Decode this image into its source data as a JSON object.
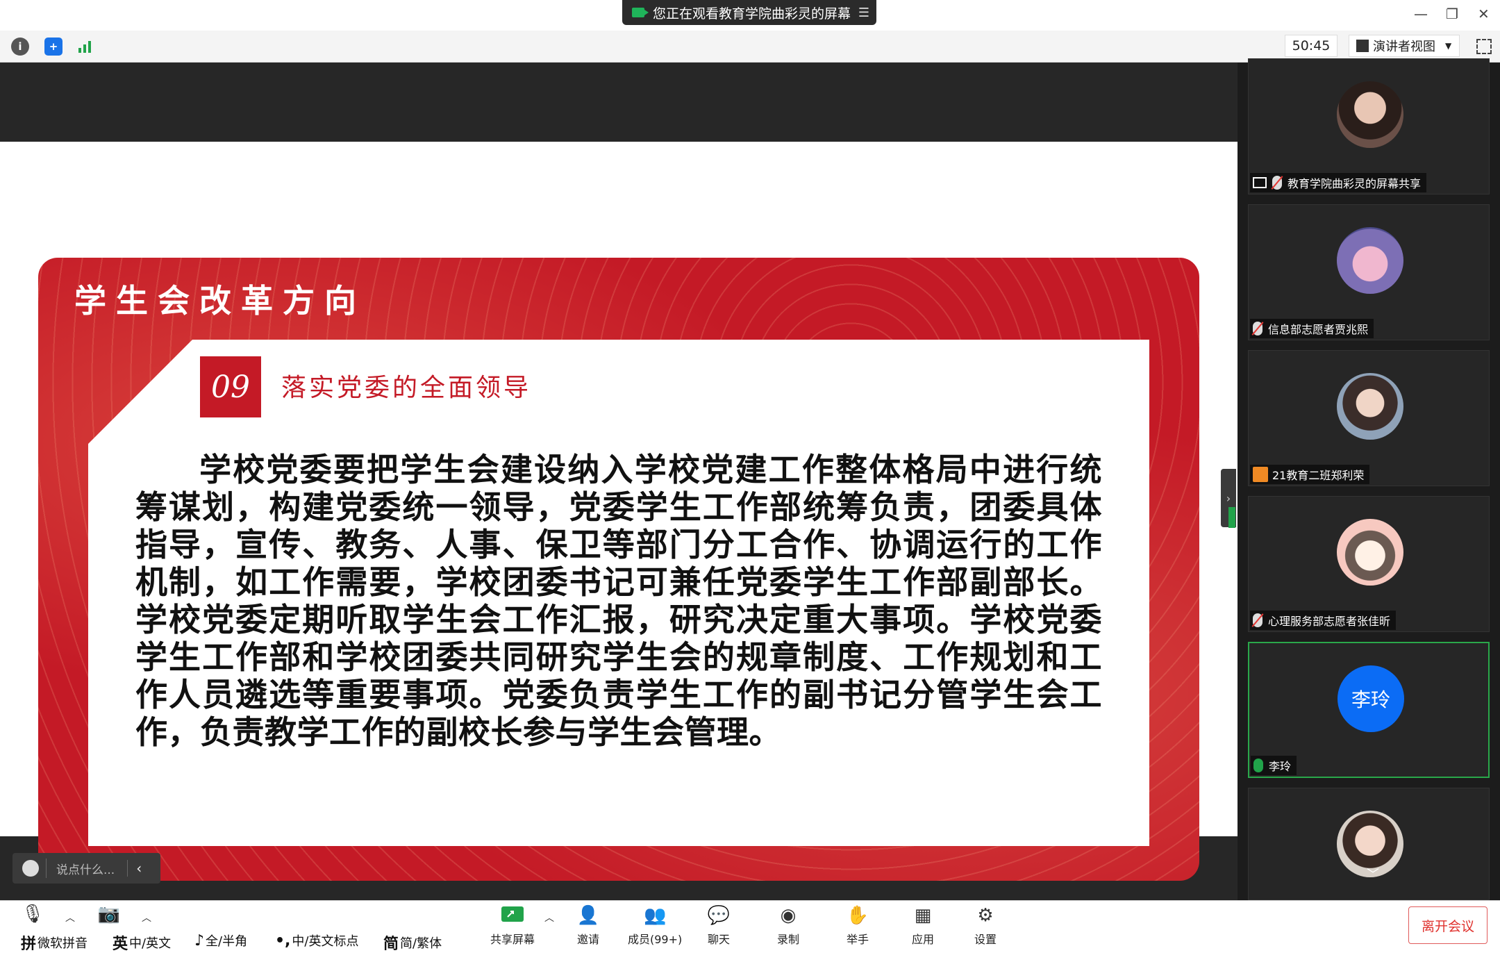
{
  "banner": {
    "text": "您正在观看教育学院曲彩灵的屏幕",
    "menu_icon": "menu-icon"
  },
  "window_controls": {
    "minimize": "—",
    "restore": "❐",
    "close": "✕"
  },
  "topbar": {
    "timer": "50:45",
    "view_mode": "演讲者视图"
  },
  "slide": {
    "title": "学生会改革方向",
    "number": "09",
    "subtitle": "落实党委的全面领导",
    "body": "学校党委要把学生会建设纳入学校党建工作整体格局中进行统筹谋划，构建党委统一领导，党委学生工作部统筹负责，团委具体指导，宣传、教务、人事、保卫等部门分工合作、协调运行的工作机制，如工作需要，学校团委书记可兼任党委学生工作部副部长。学校党委定期听取学生会工作汇报，研究决定重大事项。学校党委学生工作部和学校团委共同研究学生会的规章制度、工作规划和工作人员遴选等重要事项。党委负责学生工作的副书记分管学生会工作，负责教学工作的副校长参与学生会管理。",
    "colors": {
      "red": "#c41a26",
      "white": "#ffffff"
    }
  },
  "chat_input": {
    "placeholder": "说点什么..."
  },
  "participants": [
    {
      "name": "教育学院曲彩灵的屏幕共享",
      "type": "screen-share",
      "muted": true
    },
    {
      "name": "信息部志愿者贾兆熙",
      "type": "avatar",
      "muted": true
    },
    {
      "name": "21教育二班郑利荣",
      "type": "avatar",
      "muted": false
    },
    {
      "name": "心理服务部志愿者张佳昕",
      "type": "avatar",
      "muted": true
    },
    {
      "name": "李玲",
      "type": "initials",
      "initials": "李玲",
      "muted": false,
      "active": true
    }
  ],
  "bottombar": {
    "ime": [
      "微软拼音",
      "中/英文",
      "全/半角",
      "中/英文标点",
      "简/繁体"
    ],
    "ime_glyphs": [
      "拼",
      "英",
      "♪",
      "•,",
      "简"
    ],
    "share": "共享屏幕",
    "invite": "邀请",
    "members": "成员(99+)",
    "chat": "聊天",
    "record": "录制",
    "raise_hand": "举手",
    "apps": "应用",
    "settings": "设置",
    "leave": "离开会议"
  }
}
